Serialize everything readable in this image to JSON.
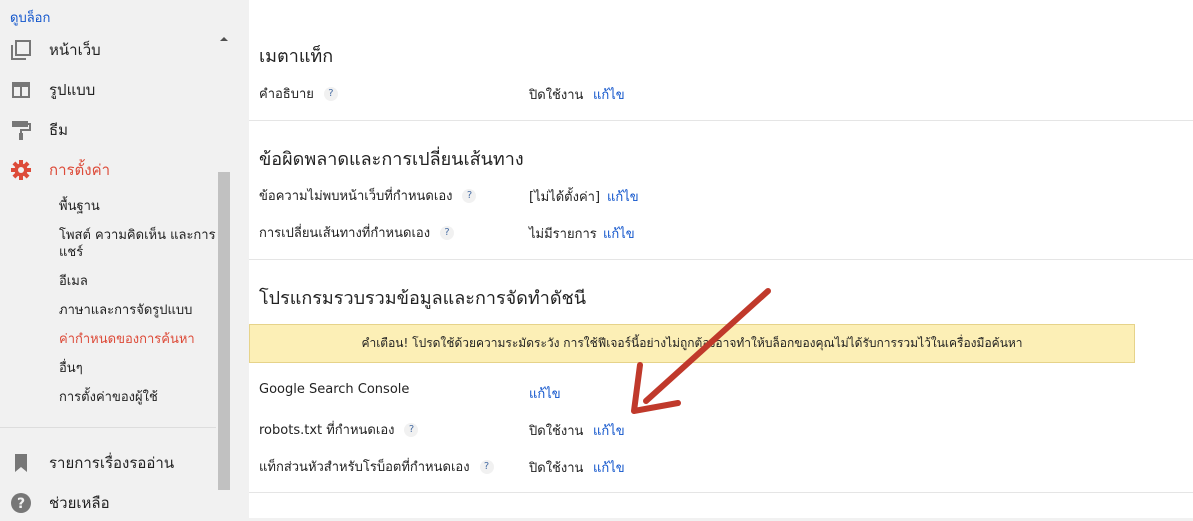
{
  "sidebar": {
    "view_blog": "ดูบล็อก",
    "nav": [
      {
        "label": "หน้าเว็บ",
        "icon": "pages-icon"
      },
      {
        "label": "รูปแบบ",
        "icon": "layout-icon"
      },
      {
        "label": "ธีม",
        "icon": "theme-icon"
      },
      {
        "label": "การตั้งค่า",
        "icon": "gear-icon"
      }
    ],
    "sub_items": [
      "พื้นฐาน",
      "โพสต์ ความคิดเห็น และการแชร์",
      "อีเมล",
      "ภาษาและการจัดรูปแบบ",
      "ค่ากำหนดของการค้นหา",
      "อื่นๆ",
      "การตั้งค่าของผู้ใช้"
    ],
    "bottom_nav": [
      {
        "label": "รายการเรื่องรออ่าน",
        "icon": "bookmark-icon"
      },
      {
        "label": "ช่วยเหลือ",
        "icon": "help-icon"
      }
    ]
  },
  "main": {
    "meta_section": {
      "title": "เมตาแท็ก",
      "rows": [
        {
          "label": "คำอธิบาย",
          "value": "ปิดใช้งาน",
          "edit": "แก้ไข"
        }
      ]
    },
    "errors_section": {
      "title": "ข้อผิดพลาดและการเปลี่ยนเส้นทาง",
      "rows": [
        {
          "label": "ข้อความไม่พบหน้าเว็บที่กำหนดเอง",
          "value": "[ไม่ได้ตั้งค่า]",
          "edit": "แก้ไข"
        },
        {
          "label": "การเปลี่ยนเส้นทางที่กำหนดเอง",
          "value": "ไม่มีรายการ",
          "edit": "แก้ไข"
        }
      ]
    },
    "crawlers_section": {
      "title": "โปรแกรมรวบรวมข้อมูลและการจัดทำดัชนี",
      "warning": "คำเตือน! โปรดใช้ด้วยความระมัดระวัง การใช้ฟีเจอร์นี้อย่างไม่ถูกต้องอาจทำให้บล็อกของคุณไม่ได้รับการรวมไว้ในเครื่องมือค้นหา",
      "rows": [
        {
          "label": "Google Search Console",
          "value": "",
          "edit": "แก้ไข"
        },
        {
          "label": "robots.txt ที่กำหนดเอง",
          "value": "ปิดใช้งาน",
          "edit": "แก้ไข"
        },
        {
          "label": "แท็กส่วนหัวสำหรับโรบ็อตที่กำหนดเอง",
          "value": "ปิดใช้งาน",
          "edit": "แก้ไข"
        }
      ]
    },
    "help_glyph": "?"
  },
  "colors": {
    "accent": "#dd4b39",
    "link": "#1155cc",
    "arrow": "#c0392b",
    "warning_bg": "#fcefb6"
  }
}
